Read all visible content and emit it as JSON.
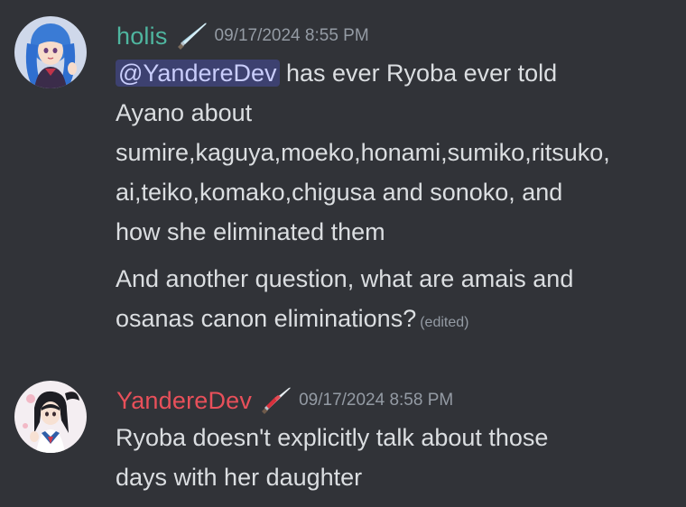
{
  "colors": {
    "background": "#313338",
    "holis_name": "#4fb6a0",
    "yanderedev_name": "#e8505a",
    "timestamp": "#949ba4",
    "text": "#dbdee1",
    "mention_bg": "#3c4270",
    "mention_text": "#c9cdfb"
  },
  "messages": [
    {
      "author": "holis",
      "role_icon": "knife-icon",
      "timestamp": "09/17/2024 8:55 PM",
      "mention": "@YandereDev",
      "paragraph1_lines": [
        " has ever Ryoba ever told",
        "Ayano about",
        "sumire,kaguya,moeko,honami,sumiko,ritsuko,",
        "ai,teiko,komako,chigusa and sonoko, and",
        "how she eliminated them"
      ],
      "paragraph2_lines": [
        "And another question, what are amais and",
        "osanas canon eliminations?"
      ],
      "edited_label": "(edited)"
    },
    {
      "author": "YandereDev",
      "role_icon": "bloody-knife-icon",
      "timestamp": "09/17/2024 8:58 PM",
      "paragraph1_lines": [
        "Ryoba doesn't explicitly talk about those",
        "days with her daughter"
      ]
    }
  ]
}
